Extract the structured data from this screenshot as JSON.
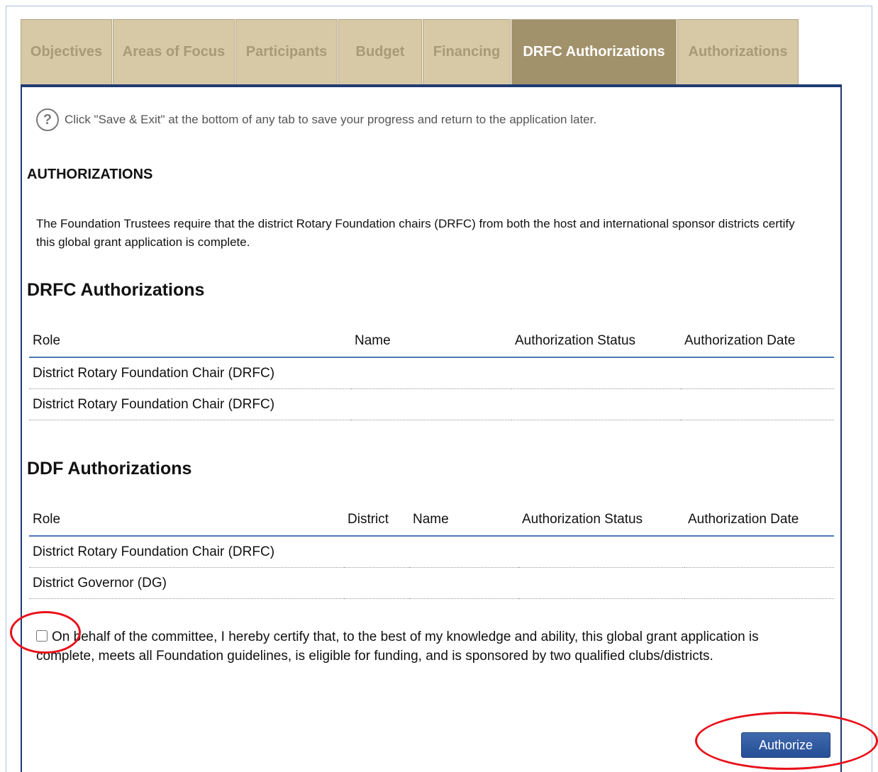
{
  "tabs": [
    {
      "label": "Objectives",
      "active": false
    },
    {
      "label": "Areas of Focus",
      "active": false
    },
    {
      "label": "Participants",
      "active": false
    },
    {
      "label": "Budget",
      "active": false
    },
    {
      "label": "Financing",
      "active": false
    },
    {
      "label": "DRFC Authorizations",
      "active": true
    },
    {
      "label": "Authorizations",
      "active": false
    }
  ],
  "help": {
    "icon": "question-circle-icon",
    "text": "Click \"Save & Exit\" at the bottom of any tab to save your progress and return to the application later."
  },
  "page_title": "AUTHORIZATIONS",
  "intro": "The Foundation Trustees require that the district Rotary Foundation chairs (DRFC) from both the host and international sponsor districts certify this global grant application is complete.",
  "drfc": {
    "heading": "DRFC Authorizations",
    "columns": [
      "Role",
      "Name",
      "Authorization Status",
      "Authorization Date"
    ],
    "rows": [
      {
        "role": "District Rotary Foundation Chair (DRFC)"
      },
      {
        "role": "District Rotary Foundation Chair (DRFC)"
      }
    ]
  },
  "ddf": {
    "heading": "DDF Authorizations",
    "columns": [
      "Role",
      "District",
      "Name",
      "Authorization Status",
      "Authorization Date"
    ],
    "rows": [
      {
        "role": "District Rotary Foundation Chair (DRFC)"
      },
      {
        "role": "District Governor (DG)"
      }
    ]
  },
  "certification": {
    "checked": false,
    "text": "On behalf of the committee, I hereby certify that, to the best of my knowledge and ability, this global grant application is complete, meets all Foundation guidelines, is eligible for funding, and is sponsored by two qualified clubs/districts."
  },
  "authorize_button": "Authorize",
  "colors": {
    "tab": "#d7c9a6",
    "tab_active": "#a2926b",
    "panel_border": "#1f3b73",
    "button": "#2d5aa0",
    "highlight_ring": "#e8101a"
  }
}
